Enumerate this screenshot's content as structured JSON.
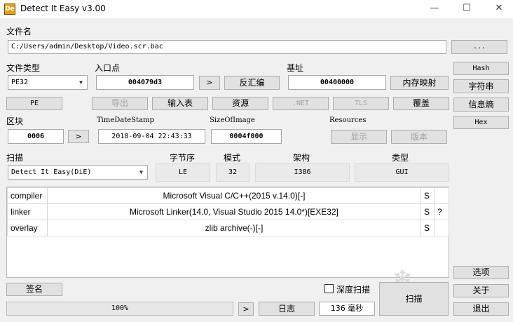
{
  "window": {
    "title": "Detect It Easy v3.00",
    "icon": "die-logo-icon",
    "minimize": "—",
    "maximize": "☐",
    "close": "✕"
  },
  "file": {
    "label": "文件名",
    "path": "C:/Users/admin/Desktop/Video.scr.bac",
    "browse": "..."
  },
  "filetype": {
    "label": "文件类型",
    "value": "PE32"
  },
  "entry": {
    "label": "入口点",
    "value": "004079d3",
    "next": ">",
    "disasm": "反汇编"
  },
  "base": {
    "label": "基址",
    "value": "00400000",
    "memmap": "内存映射"
  },
  "side": {
    "hash": "Hash",
    "strings": "字符串",
    "entropy": "信息熵",
    "hex": "Hex"
  },
  "pebar": {
    "pe": "PE",
    "export": "导出",
    "import": "输入表",
    "resource": "资源",
    "net": ".NET",
    "tls": "TLS",
    "overlay": "覆盖"
  },
  "section": {
    "label": "区块",
    "value": "0006",
    "next": ">"
  },
  "timestamp": {
    "label": "TimeDateStamp",
    "value": "2018-09-04 22:43:33"
  },
  "sizeofimage": {
    "label": "SizeOfImage",
    "value": "0004f000"
  },
  "resources": {
    "label": "Resources",
    "show": "显示",
    "version": "版本"
  },
  "scan": {
    "label": "扫描",
    "engine": "Detect It Easy(DiE)",
    "endian_label": "字节序",
    "endian": "LE",
    "mode_label": "模式",
    "mode": "32",
    "arch_label": "架构",
    "arch": "I386",
    "type_label": "类型",
    "type": "GUI"
  },
  "results": [
    {
      "kind": "compiler",
      "name": "Microsoft Visual C/C++(2015 v.14.0)[-]",
      "s": "S",
      "q": ""
    },
    {
      "kind": "linker",
      "name": "Microsoft Linker(14.0, Visual Studio 2015 14.0*)[EXE32]",
      "s": "S",
      "q": "?"
    },
    {
      "kind": "overlay",
      "name": "zlib archive(-)[-]",
      "s": "S",
      "q": ""
    }
  ],
  "bottom": {
    "signature": "签名",
    "deep_scan": "深度扫描",
    "deep_scan_checked": false,
    "progress": "100%",
    "progress_value": 100,
    "progress_next": ">",
    "log": "日志",
    "time": "136 毫秒",
    "scan": "扫描",
    "options": "选项",
    "about": "关于",
    "exit": "退出"
  }
}
